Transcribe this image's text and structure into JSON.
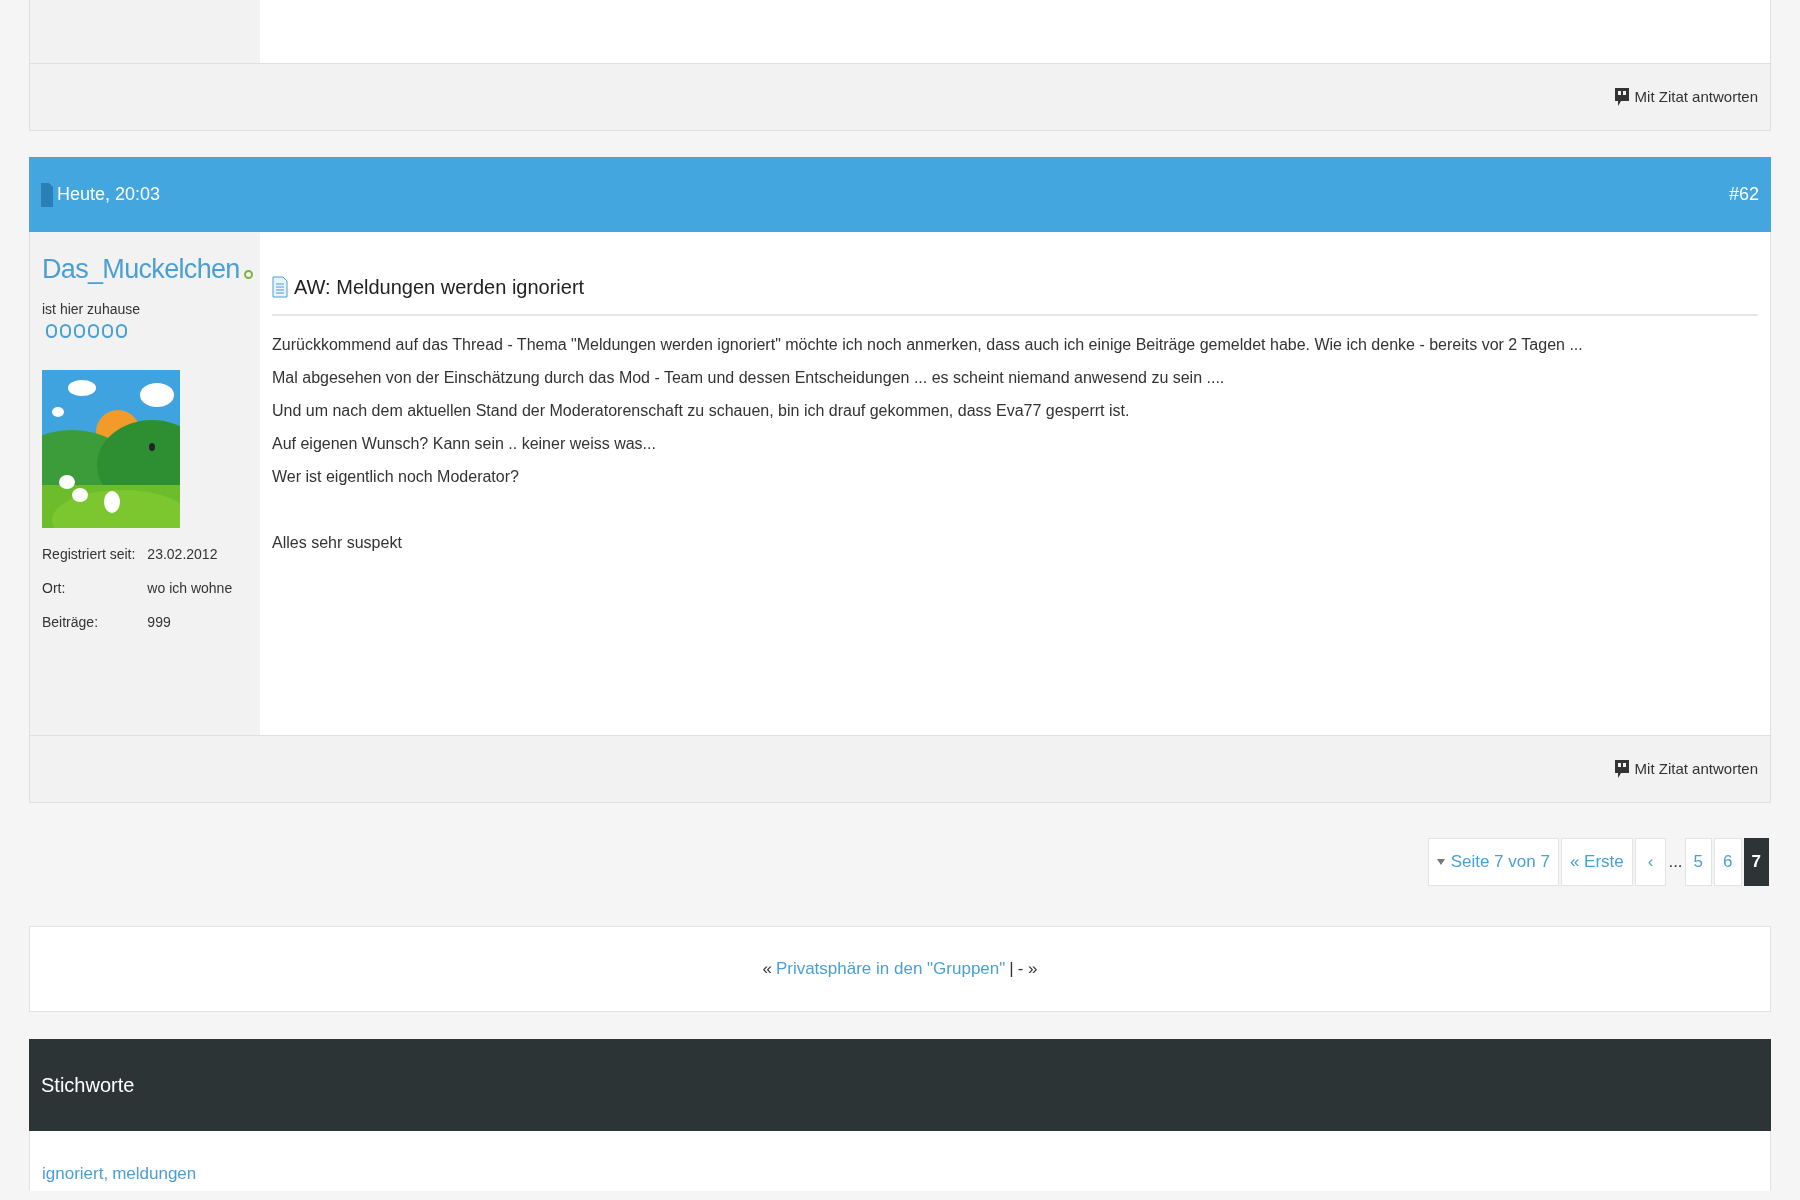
{
  "previous_post": {
    "reply_button": "Mit Zitat antworten"
  },
  "post": {
    "date": "Heute, 20:03",
    "number": "#62",
    "author": {
      "name": "Das_Muckelchen",
      "online": true,
      "rank": "ist hier zuhause",
      "stars": 0,
      "details": [
        {
          "label": "Registriert seit:",
          "value": "23.02.2012"
        },
        {
          "label": "Ort:",
          "value": "wo ich wohne"
        },
        {
          "label": "Beiträge:",
          "value": "999"
        }
      ]
    },
    "title": "AW: Meldungen werden ignoriert",
    "lines": [
      "Zurückkommend auf das Thread - Thema \"Meldungen werden ignoriert\" möchte ich noch anmerken, dass auch ich einige Beiträge gemeldet habe. Wie ich denke - bereits vor 2 Tagen ...",
      "Mal abgesehen von der Einschätzung durch das Mod - Team und dessen Entscheidungen ... es scheint niemand anwesend zu sein ....",
      "Und um nach dem aktuellen Stand der Moderatorenschaft zu schauen, bin ich drauf gekommen, dass Eva77 gesperrt ist.",
      "Auf eigenen Wunsch? Kann sein .. keiner weiss was...",
      "Wer ist eigentlich noch Moderator?"
    ],
    "closing": "Alles sehr suspekt",
    "reply_button": "Mit Zitat antworten"
  },
  "pagination": {
    "page_info": "Seite 7 von 7",
    "first": "« Erste",
    "prev": "‹",
    "ellipsis": "...",
    "pages": [
      {
        "label": "5",
        "selected": false
      },
      {
        "label": "6",
        "selected": false
      },
      {
        "label": "7",
        "selected": true
      }
    ]
  },
  "thread_nav": {
    "prev_marker": "«",
    "prev_link": "Privatsphäre in den \"Gruppen\"",
    "separator": "|",
    "next": "- »"
  },
  "tags": {
    "title": "Stichworte",
    "separator": ",",
    "items": [
      "ignoriert",
      "meldungen"
    ]
  }
}
